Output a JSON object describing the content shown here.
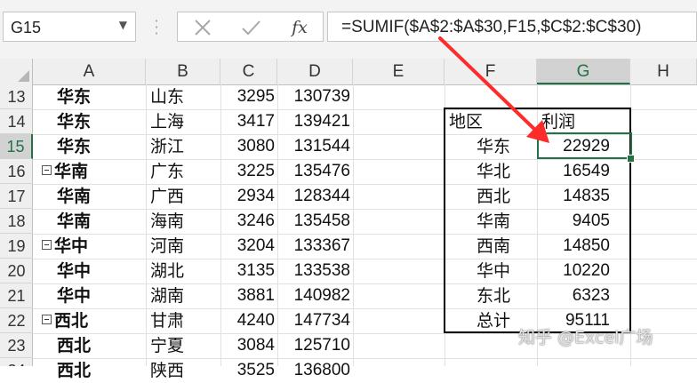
{
  "name_box": {
    "value": "G15"
  },
  "formula_bar": {
    "cancel_icon": "x-icon",
    "enter_icon": "check-icon",
    "function_label": "fx",
    "formula": "=SUMIF($A$2:$A$30,F15,$C$2:$C$30)"
  },
  "columns": [
    "A",
    "B",
    "C",
    "D",
    "E",
    "F",
    "G",
    "H"
  ],
  "selected_column": "G",
  "rows": [
    {
      "num": "13",
      "a": "华东",
      "b": "山东",
      "c": "3295",
      "d": "130739",
      "group": false
    },
    {
      "num": "14",
      "a": "华东",
      "b": "上海",
      "c": "3417",
      "d": "139421",
      "group": false
    },
    {
      "num": "15",
      "a": "华东",
      "b": "浙江",
      "c": "3080",
      "d": "131544",
      "group": false
    },
    {
      "num": "16",
      "a": "华南",
      "b": "广东",
      "c": "3225",
      "d": "135476",
      "group": true
    },
    {
      "num": "17",
      "a": "华南",
      "b": "广西",
      "c": "2934",
      "d": "128344",
      "group": false
    },
    {
      "num": "18",
      "a": "华南",
      "b": "海南",
      "c": "3246",
      "d": "135458",
      "group": false
    },
    {
      "num": "19",
      "a": "华中",
      "b": "河南",
      "c": "3204",
      "d": "133367",
      "group": true
    },
    {
      "num": "20",
      "a": "华中",
      "b": "湖北",
      "c": "3135",
      "d": "133538",
      "group": false
    },
    {
      "num": "21",
      "a": "华中",
      "b": "湖南",
      "c": "3881",
      "d": "140982",
      "group": false
    },
    {
      "num": "22",
      "a": "西北",
      "b": "甘肃",
      "c": "4240",
      "d": "147734",
      "group": true
    },
    {
      "num": "23",
      "a": "西北",
      "b": "宁夏",
      "c": "3084",
      "d": "125710",
      "group": false
    },
    {
      "num": "24",
      "a": "西北",
      "b": "陕西",
      "c": "3525",
      "d": "136800",
      "group": false
    }
  ],
  "selected_row": "15",
  "summary": {
    "header": {
      "region": "地区",
      "profit": "利润"
    },
    "items": [
      {
        "region": "华东",
        "profit": "22929"
      },
      {
        "region": "华北",
        "profit": "16549"
      },
      {
        "region": "西北",
        "profit": "14835"
      },
      {
        "region": "华南",
        "profit": "9405"
      },
      {
        "region": "西南",
        "profit": "14850"
      },
      {
        "region": "华中",
        "profit": "10220"
      },
      {
        "region": "东北",
        "profit": "6323"
      },
      {
        "region": "总计",
        "profit": "95111"
      }
    ]
  },
  "annotation": {
    "arrow_color": "#ff2a2a"
  },
  "watermark": "知乎 @Excel广场",
  "accent_color": "#217346"
}
